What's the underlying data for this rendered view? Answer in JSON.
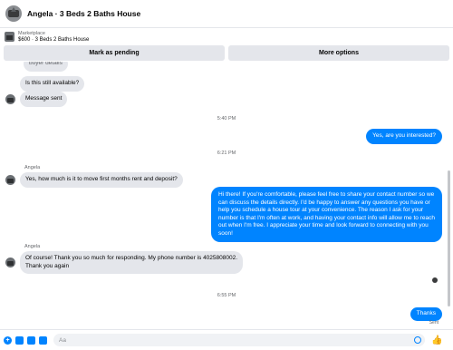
{
  "header": {
    "title": "Angela · 3 Beds 2 Baths House"
  },
  "marketplace": {
    "kicker": "Marketplace",
    "listing": "$600 · 3 Beds 2 Baths House"
  },
  "actions": {
    "pending": "Mark as pending",
    "more": "More options"
  },
  "thread": {
    "partial_top": "buyer details",
    "msg_available": "Is this still available?",
    "msg_sent_note": "Message sent",
    "time1": "5:40 PM",
    "out1": "Yes, are you interested?",
    "time2": "6:21 PM",
    "sender1": "Angela",
    "in2": "Yes, how much is it to move first months rent and deposit?",
    "out2": "Hi there! If you're comfortable, please feel free to share your contact number so we can discuss the details directly. I'd be happy to answer any questions you have or help you schedule a house tour at your convenience. The reason I ask for your number is that I'm often at work, and having your contact info will allow me to reach out when I'm free. I appreciate your time and look forward to connecting with you soon!",
    "sender2": "Angela",
    "in3_line1": "Of course! Thank you so much for responding.  My phone number is 4025808002.",
    "in3_line2": "Thank you again",
    "time3": "6:55 PM",
    "out3": "Thanks",
    "status": "Sent"
  },
  "composer": {
    "placeholder": "Aa"
  }
}
